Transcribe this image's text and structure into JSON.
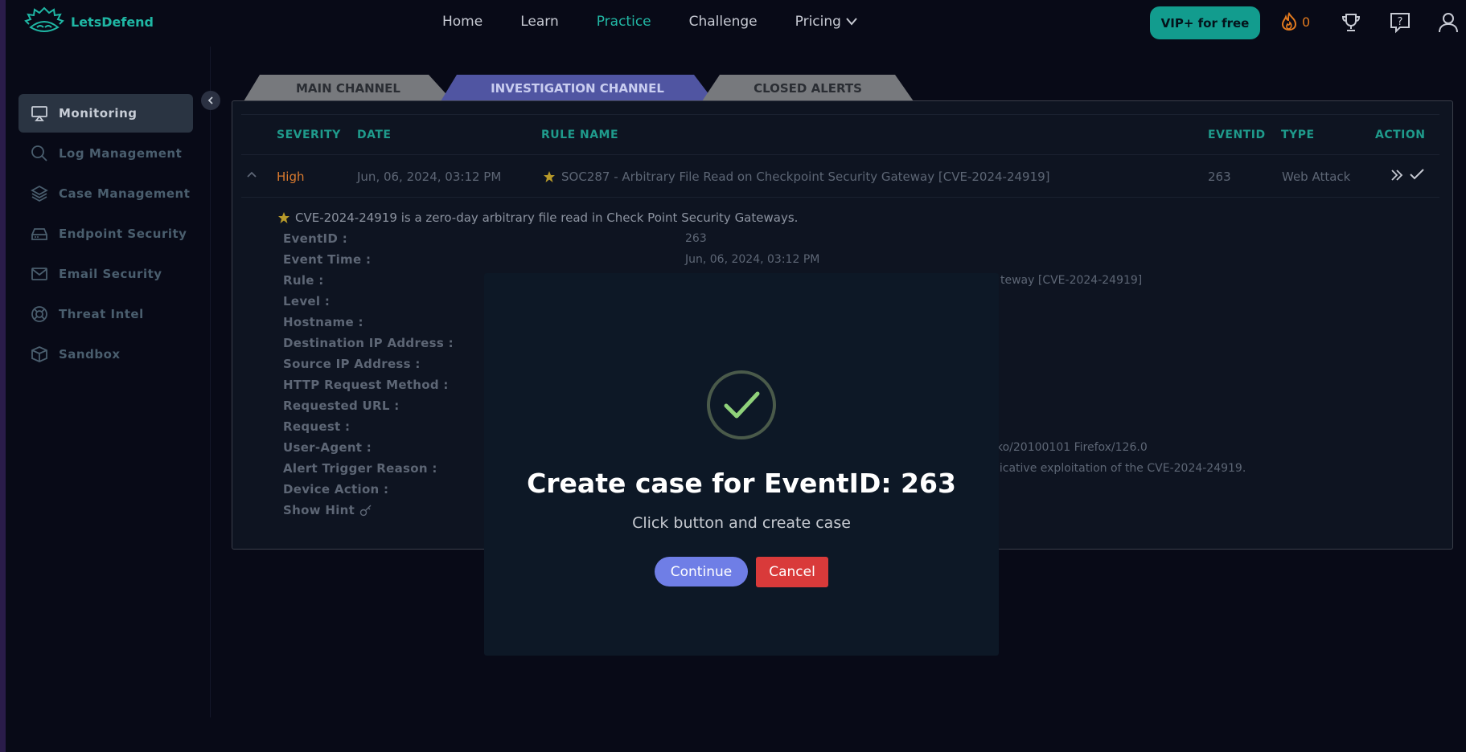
{
  "brand": {
    "name": "LetsDefend"
  },
  "nav": {
    "items": [
      {
        "label": "Home"
      },
      {
        "label": "Learn"
      },
      {
        "label": "Practice",
        "active": true
      },
      {
        "label": "Challenge"
      },
      {
        "label": "Pricing"
      }
    ],
    "vip_label": "VIP+ for free",
    "streak_count": "0"
  },
  "sidebar": {
    "items": [
      {
        "label": "Monitoring",
        "icon": "monitor-icon",
        "active": true
      },
      {
        "label": "Log Management",
        "icon": "search-icon"
      },
      {
        "label": "Case Management",
        "icon": "layers-icon"
      },
      {
        "label": "Endpoint Security",
        "icon": "hard-drive-icon"
      },
      {
        "label": "Email Security",
        "icon": "mail-icon"
      },
      {
        "label": "Threat Intel",
        "icon": "lifebuoy-icon"
      },
      {
        "label": "Sandbox",
        "icon": "box-icon"
      }
    ]
  },
  "tabs": [
    {
      "label": "MAIN CHANNEL"
    },
    {
      "label": "INVESTIGATION CHANNEL",
      "active": true
    },
    {
      "label": "CLOSED ALERTS"
    }
  ],
  "table": {
    "headers": {
      "severity": "SEVERITY",
      "date": "DATE",
      "rule": "RULE NAME",
      "eventid": "EVENTID",
      "type": "TYPE",
      "action": "ACTION"
    },
    "row": {
      "severity": "High",
      "date": "Jun, 06, 2024, 03:12 PM",
      "rule": "SOC287 - Arbitrary File Read on Checkpoint Security Gateway [CVE-2024-24919]",
      "eventid": "263",
      "type": "Web Attack"
    }
  },
  "details": {
    "description": "CVE-2024-24919 is a zero-day arbitrary file read in Check Point Security Gateways.",
    "labels": {
      "eventid": "EventID :",
      "event_time": "Event Time :",
      "rule": "Rule :",
      "level": "Level :",
      "hostname": "Hostname :",
      "dest_ip": "Destination IP Address :",
      "src_ip": "Source IP Address :",
      "http_method": "HTTP Request Method :",
      "url": "Requested URL :",
      "request": "Request :",
      "user_agent": "User-Agent :",
      "trigger_reason": "Alert Trigger Reason :",
      "device_action": "Device Action :",
      "show_hint": "Show Hint"
    },
    "values": {
      "eventid": "263",
      "event_time": "Jun, 06, 2024, 03:12 PM",
      "rule_fragment": "teway [CVE-2024-24919]",
      "user_agent_fragment": "ko/20100101 Firefox/126.0",
      "trigger_fragment": "licative exploitation of the CVE-2024-24919."
    }
  },
  "modal": {
    "title": "Create case for EventID: 263",
    "subtitle": "Click button and create case",
    "continue_label": "Continue",
    "cancel_label": "Cancel"
  },
  "colors": {
    "accent": "#1fb7a4",
    "severity_high": "#d97a2e",
    "continue": "#6f7ee6",
    "cancel": "#d93a3a",
    "check": "#8fd17a"
  }
}
